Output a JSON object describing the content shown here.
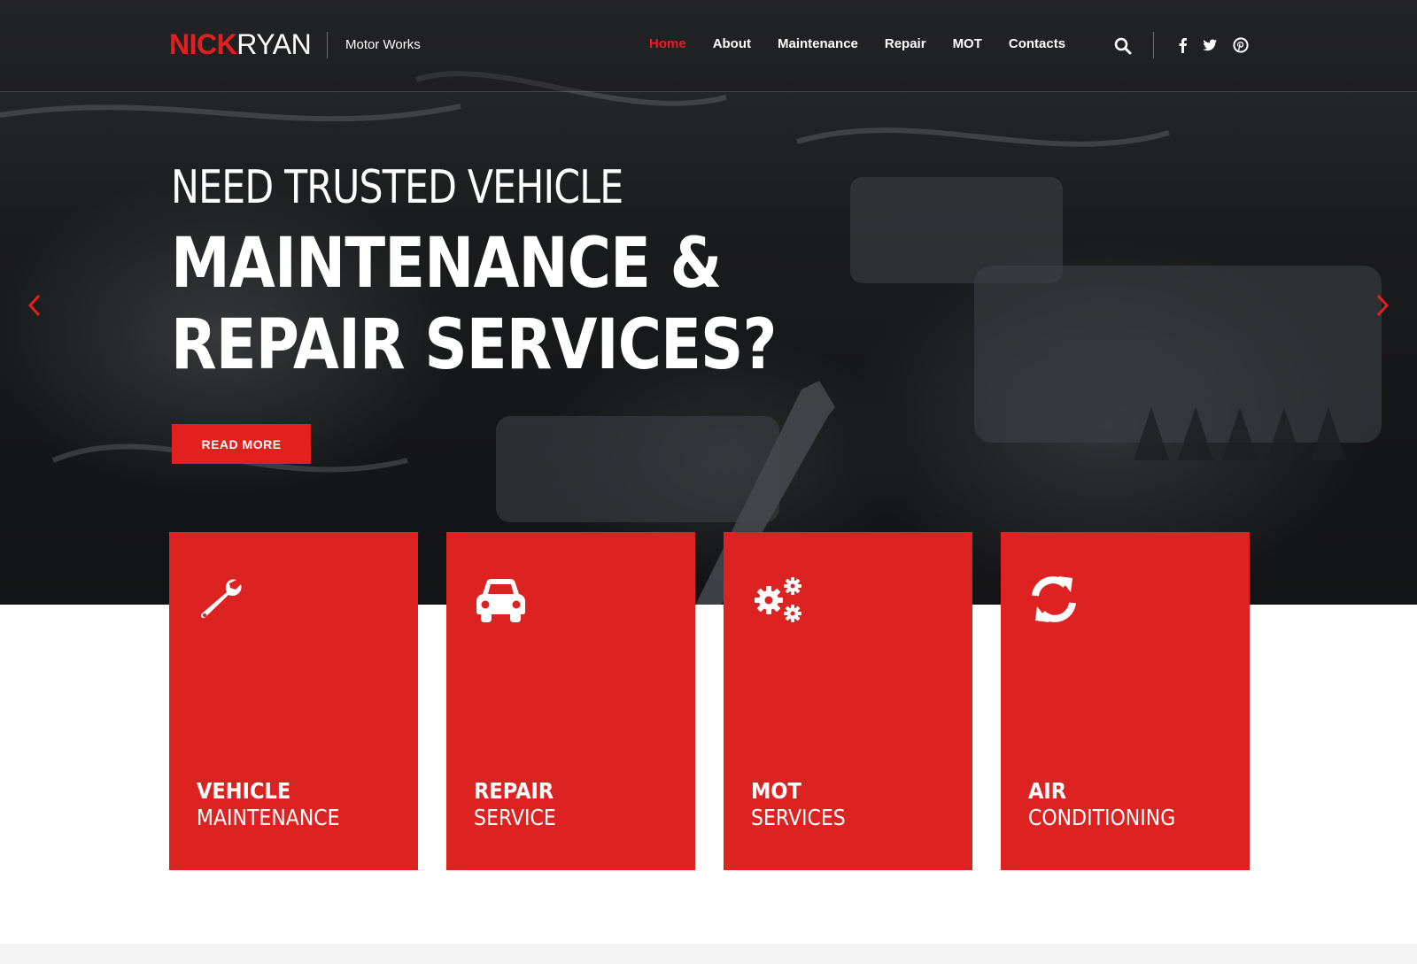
{
  "brand": {
    "logo_part1": "NICK",
    "logo_part2": "RYAN",
    "tagline": "Motor Works"
  },
  "nav": {
    "items": [
      {
        "label": "Home",
        "active": true
      },
      {
        "label": "About"
      },
      {
        "label": "Maintenance"
      },
      {
        "label": "Repair"
      },
      {
        "label": "MOT"
      },
      {
        "label": "Contacts"
      }
    ],
    "search_icon": "search-icon",
    "social": [
      "facebook-icon",
      "twitter-icon",
      "pinterest-icon"
    ]
  },
  "hero": {
    "line1": "NEED TRUSTED VEHICLE",
    "line2": "MAINTENANCE &",
    "line3": "REPAIR SERVICES?",
    "button": "READ MORE",
    "prev_icon": "chevron-left-icon",
    "next_icon": "chevron-right-icon"
  },
  "services": [
    {
      "title": "VEHICLE",
      "subtitle": "MAINTENANCE",
      "icon": "wrench-icon"
    },
    {
      "title": "REPAIR",
      "subtitle": "SERVICE",
      "icon": "car-icon"
    },
    {
      "title": "MOT",
      "subtitle": "SERVICES",
      "icon": "gears-icon"
    },
    {
      "title": "AIR",
      "subtitle": "CONDITIONING",
      "icon": "refresh-icon"
    }
  ],
  "colors": {
    "accent": "#e3201f",
    "card": "#dd2222",
    "text_light": "#ffffff"
  }
}
